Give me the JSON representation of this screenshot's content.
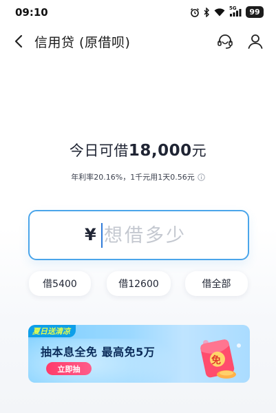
{
  "status_bar": {
    "time": "09:10",
    "network": "5G",
    "battery": "99"
  },
  "nav": {
    "title": "信用贷 (原借呗)",
    "icons": [
      "back-arrow-icon",
      "customer-service-icon",
      "user-icon"
    ]
  },
  "headline": {
    "prefix": "今日可借",
    "amount": "18,000",
    "suffix": "元"
  },
  "rate": {
    "text": "年利率20.16%，1千元用1天0.56元",
    "icon": "info-icon"
  },
  "amount_input": {
    "currency": "¥",
    "placeholder": "想借多少",
    "value": ""
  },
  "quick_buttons": [
    {
      "label": "借5400"
    },
    {
      "label": "借12600"
    },
    {
      "label": "借全部"
    }
  ],
  "banner": {
    "tag": "夏日送清凉",
    "title": "抽本息全免 最高免5万",
    "button": "立即抽",
    "envelope_text": "免",
    "colors": {
      "accent": "#ff3b6a",
      "tag_bg": "#0e9fe9",
      "title": "#0b2c5a"
    }
  },
  "colors": {
    "input_border": "#4aa5ea",
    "text_primary": "#1f2433",
    "placeholder": "#c4c8d0"
  }
}
